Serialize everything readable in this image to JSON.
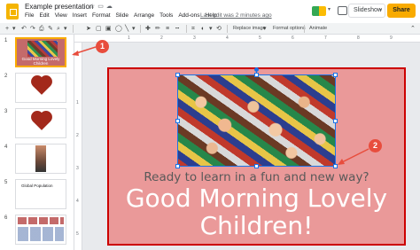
{
  "document": {
    "title": "Example presentation",
    "last_edit": "Last edit was 2 minutes ago"
  },
  "menu": [
    "File",
    "Edit",
    "View",
    "Insert",
    "Format",
    "Slide",
    "Arrange",
    "Tools",
    "Add-ons",
    "Help"
  ],
  "header": {
    "slideshow_label": "Slideshow",
    "share_label": "Share",
    "share_color": "#f9ab00"
  },
  "toolbar": {
    "replace_image_label": "Replace image",
    "format_options_label": "Format options",
    "animate_label": "Animate"
  },
  "ruler": {
    "horizontal_ticks": [
      "1",
      "2",
      "3",
      "4",
      "5",
      "6",
      "7",
      "8",
      "9"
    ],
    "vertical_ticks": [
      "1",
      "2",
      "3",
      "4",
      "5"
    ]
  },
  "filmstrip": {
    "slides": [
      {
        "number": "1",
        "text": "Good Morning Lovely Children",
        "selected": true
      },
      {
        "number": "2",
        "text": ""
      },
      {
        "number": "3",
        "text": ""
      },
      {
        "number": "4",
        "text": ""
      },
      {
        "number": "5",
        "text": "Global Population"
      },
      {
        "number": "6",
        "text": ""
      }
    ]
  },
  "slide": {
    "background_color": "#ea9999",
    "border_color": "#cc0000",
    "subtitle": "Ready to learn in a fun and new way?",
    "title_line1": "Good Morning Lovely",
    "title_line2": "Children!"
  },
  "annotations": {
    "badge1": "1",
    "badge2": "2",
    "color": "#e84d3d"
  }
}
